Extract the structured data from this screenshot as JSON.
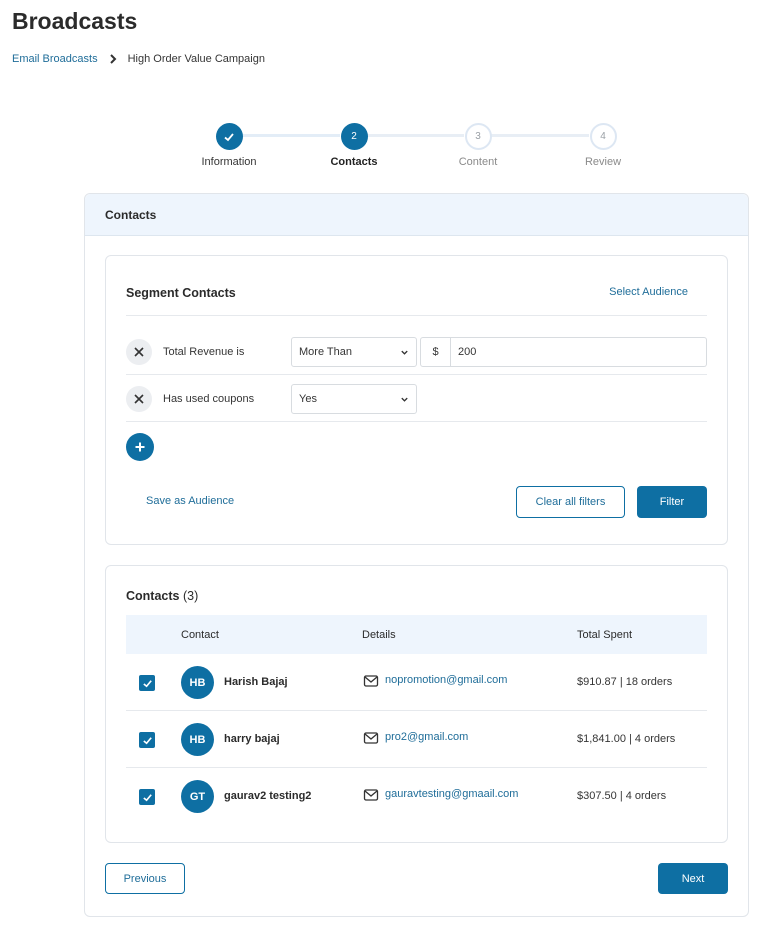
{
  "page": {
    "title": "Broadcasts"
  },
  "breadcrumb": {
    "parent": "Email Broadcasts",
    "current": "High Order Value Campaign"
  },
  "stepper": {
    "steps": [
      {
        "number": "1",
        "label": "Information",
        "state": "done"
      },
      {
        "number": "2",
        "label": "Contacts",
        "state": "active"
      },
      {
        "number": "3",
        "label": "Content",
        "state": "pending"
      },
      {
        "number": "4",
        "label": "Review",
        "state": "pending"
      }
    ]
  },
  "panel": {
    "title": "Contacts"
  },
  "segment": {
    "title": "Segment Contacts",
    "select_audience": "Select Audience",
    "filters": [
      {
        "label": "Total Revenue is",
        "operator": "More Than",
        "currency": "$",
        "value": "200"
      },
      {
        "label": "Has used coupons",
        "operator": "Yes"
      }
    ],
    "save_audience": "Save as Audience",
    "clear_filters": "Clear all filters",
    "filter_button": "Filter"
  },
  "contacts": {
    "title": "Contacts",
    "count": "(3)",
    "columns": {
      "contact": "Contact",
      "details": "Details",
      "spent": "Total Spent"
    },
    "rows": [
      {
        "initials": "HB",
        "name": "Harish Bajaj",
        "email": "nopromotion@gmail.com",
        "spent": "$910.87 | 18 orders",
        "checked": true
      },
      {
        "initials": "HB",
        "name": "harry bajaj",
        "email": "pro2@gmail.com",
        "spent": "$1,841.00 | 4 orders",
        "checked": true
      },
      {
        "initials": "GT",
        "name": "gaurav2 testing2",
        "email": "gauravtesting@gmaail.com",
        "spent": "$307.50 | 4 orders",
        "checked": true
      }
    ]
  },
  "footer": {
    "previous": "Previous",
    "next": "Next"
  },
  "colors": {
    "accent": "#0e6fa3",
    "link": "#1f6d99",
    "header_bg": "#eef5fd"
  }
}
